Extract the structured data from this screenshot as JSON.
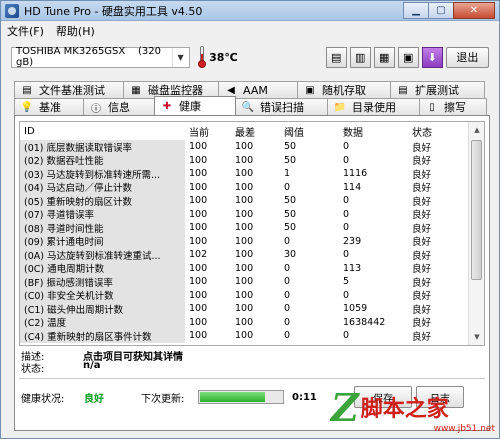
{
  "window": {
    "title": "HD Tune Pro - 硬盘实用工具 v4.50"
  },
  "menu": [
    "文件(F)",
    "帮助(H)"
  ],
  "toolbar": {
    "drive": "TOSHIBA MK3265GSX",
    "drive_size": "(320 gB)",
    "temperature": "38℃",
    "exit_label": "退出"
  },
  "tabs_row1": [
    {
      "label": "文件基准测试",
      "icon": "file-benchmark-icon",
      "glyph": "▤"
    },
    {
      "label": "磁盘监控器",
      "icon": "disk-monitor-icon",
      "glyph": "▦"
    },
    {
      "label": "AAM",
      "icon": "speaker-icon",
      "glyph": "◀"
    },
    {
      "label": "随机存取",
      "icon": "random-access-icon",
      "glyph": "▣"
    },
    {
      "label": "扩展测试",
      "icon": "extra-tests-icon",
      "glyph": "▤"
    }
  ],
  "tabs_row2": [
    {
      "label": "基准",
      "icon": "benchmark-icon",
      "glyph": "💡"
    },
    {
      "label": "信息",
      "icon": "info-icon",
      "glyph": "ⓘ"
    },
    {
      "label": "健康",
      "icon": "health-icon",
      "glyph": "✚",
      "active": true
    },
    {
      "label": "错误扫描",
      "icon": "error-scan-icon",
      "glyph": "🔍"
    },
    {
      "label": "目录使用",
      "icon": "folder-usage-icon",
      "glyph": "📁"
    },
    {
      "label": "擦写",
      "icon": "erase-icon",
      "glyph": "▯"
    }
  ],
  "health": {
    "columns": [
      "ID",
      "当前",
      "最差",
      "阈值",
      "数据",
      "状态"
    ],
    "rows": [
      [
        "(01) 底层数据读取错误率",
        "100",
        "100",
        "50",
        "0",
        "良好"
      ],
      [
        "(02) 数据吞吐性能",
        "100",
        "100",
        "50",
        "0",
        "良好"
      ],
      [
        "(03) 马达旋转到标准转速所需...",
        "100",
        "100",
        "1",
        "1116",
        "良好"
      ],
      [
        "(04) 马达启动／停止计数",
        "100",
        "100",
        "0",
        "114",
        "良好"
      ],
      [
        "(05) 重新映射的扇区计数",
        "100",
        "100",
        "50",
        "0",
        "良好"
      ],
      [
        "(07) 寻道错误率",
        "100",
        "100",
        "50",
        "0",
        "良好"
      ],
      [
        "(08) 寻道时间性能",
        "100",
        "100",
        "50",
        "0",
        "良好"
      ],
      [
        "(09) 累计通电时间",
        "100",
        "100",
        "0",
        "239",
        "良好"
      ],
      [
        "(0A) 马达旋转到标准转速重试...",
        "102",
        "100",
        "30",
        "0",
        "良好"
      ],
      [
        "(0C) 通电周期计数",
        "100",
        "100",
        "0",
        "113",
        "良好"
      ],
      [
        "(BF) 振动感测错误率",
        "100",
        "100",
        "0",
        "5",
        "良好"
      ],
      [
        "(C0) 非安全关机计数",
        "100",
        "100",
        "0",
        "0",
        "良好"
      ],
      [
        "(C1) 磁头伸出周期计数",
        "100",
        "100",
        "0",
        "1059",
        "良好"
      ],
      [
        "(C2) 温度",
        "100",
        "100",
        "0",
        "1638442",
        "良好"
      ],
      [
        "(C4) 重新映射的扇区事件计数",
        "100",
        "100",
        "0",
        "0",
        "良好"
      ]
    ]
  },
  "details": {
    "desc_label": "描述:",
    "desc_value": "点击项目可获知其详情",
    "status_label": "状态:",
    "status_value": "n/a"
  },
  "status": {
    "health_label": "健康状况:",
    "health_value": "良好",
    "next_label": "下次更新:",
    "progress": 0.8,
    "time": "0:11",
    "button1": "保存",
    "button2": "日志"
  },
  "watermark": {
    "logo": "Z",
    "text": "脚本之家",
    "url": "www.jb51.net"
  }
}
